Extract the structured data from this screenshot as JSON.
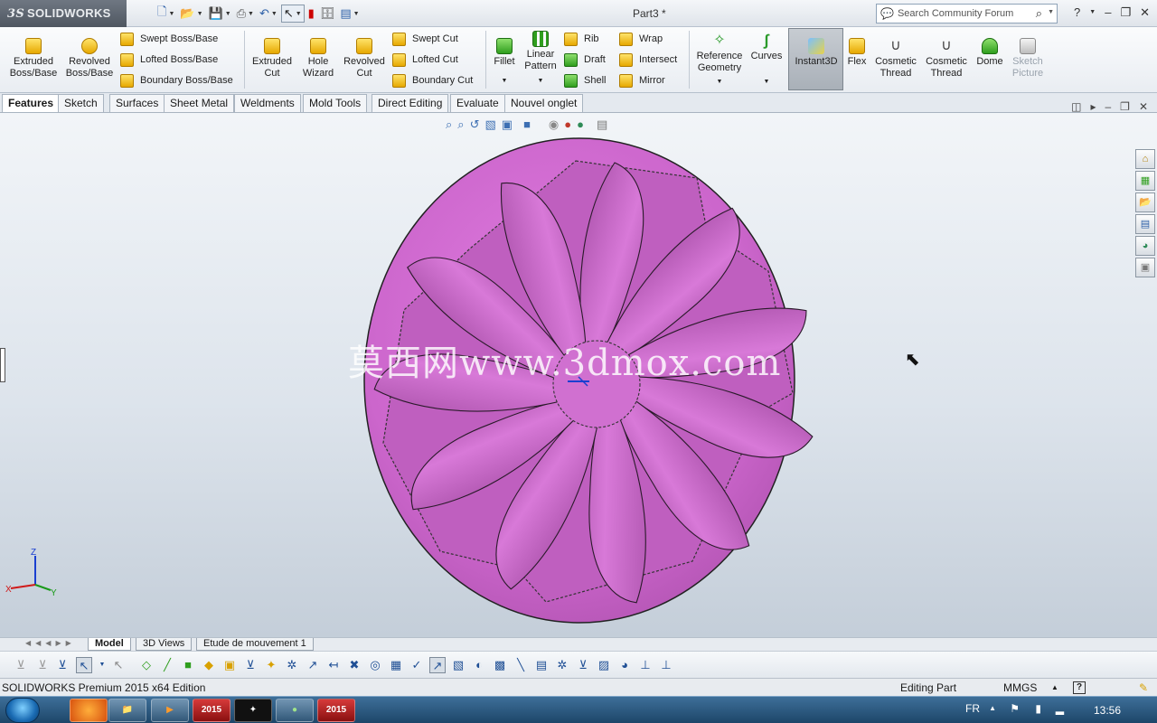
{
  "app": {
    "brand": "SOLIDWORKS",
    "document_title": "Part3 *",
    "search_placeholder": "Search Community Forum"
  },
  "ribbon": {
    "large_buttons": [
      {
        "id": "extruded-boss",
        "label": "Extruded\nBoss/Base"
      },
      {
        "id": "revolved-boss",
        "label": "Revolved\nBoss/Base"
      },
      {
        "id": "extruded-cut",
        "label": "Extruded\nCut"
      },
      {
        "id": "hole-wizard",
        "label": "Hole\nWizard"
      },
      {
        "id": "revolved-cut",
        "label": "Revolved\nCut"
      },
      {
        "id": "fillet",
        "label": "Fillet"
      },
      {
        "id": "linear-pattern",
        "label": "Linear\nPattern"
      },
      {
        "id": "reference-geometry",
        "label": "Reference\nGeometry"
      },
      {
        "id": "curves",
        "label": "Curves"
      },
      {
        "id": "instant3d",
        "label": "Instant3D"
      },
      {
        "id": "flex",
        "label": "Flex"
      },
      {
        "id": "cosmetic-thread-1",
        "label": "Cosmetic\nThread"
      },
      {
        "id": "cosmetic-thread-2",
        "label": "Cosmetic\nThread"
      },
      {
        "id": "dome",
        "label": "Dome"
      },
      {
        "id": "sketch-picture",
        "label": "Sketch\nPicture"
      }
    ],
    "small_buttons": [
      {
        "id": "swept-boss",
        "label": "Swept Boss/Base"
      },
      {
        "id": "lofted-boss",
        "label": "Lofted Boss/Base"
      },
      {
        "id": "boundary-boss",
        "label": "Boundary Boss/Base"
      },
      {
        "id": "swept-cut",
        "label": "Swept Cut"
      },
      {
        "id": "lofted-cut",
        "label": "Lofted Cut"
      },
      {
        "id": "boundary-cut",
        "label": "Boundary Cut"
      },
      {
        "id": "rib",
        "label": "Rib"
      },
      {
        "id": "draft",
        "label": "Draft"
      },
      {
        "id": "shell",
        "label": "Shell"
      },
      {
        "id": "wrap",
        "label": "Wrap"
      },
      {
        "id": "intersect",
        "label": "Intersect"
      },
      {
        "id": "mirror",
        "label": "Mirror"
      }
    ]
  },
  "tabs": [
    "Features",
    "Sketch",
    "Surfaces",
    "Sheet Metal",
    "Weldments",
    "Mold Tools",
    "Direct Editing",
    "Evaluate",
    "Nouvel onglet"
  ],
  "active_tab": "Features",
  "viewport": {
    "watermark": "莫西网www.3dmox.com",
    "model_color": "#cc66cc",
    "triad": {
      "x": "X",
      "y": "Y",
      "z": "Z"
    }
  },
  "bottom_tabs": [
    "Model",
    "3D Views",
    "Etude de mouvement 1"
  ],
  "status": {
    "left": "SOLIDWORKS Premium 2015 x64 Edition",
    "mode": "Editing Part",
    "units": "MMGS",
    "help": "?"
  },
  "taskbar": {
    "lang": "FR",
    "time": "13:56",
    "app_label": "2015"
  }
}
